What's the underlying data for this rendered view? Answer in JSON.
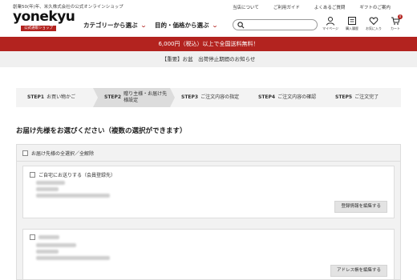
{
  "header": {
    "tagline": "創業50(年)年、米久株式会社の公式オンラインショップ",
    "logo": "yonekyu",
    "logo_sub": "公式通販ショップ",
    "nav_category": "カテゴリーから選ぶ",
    "nav_occasion": "目的・価格から選ぶ",
    "util_links": [
      "当店について",
      "ご利用ガイド",
      "よくあるご質問",
      "ギフトのご案内"
    ],
    "icons": [
      {
        "name": "user-icon",
        "label": "マイページ"
      },
      {
        "name": "history-icon",
        "label": "購入履歴"
      },
      {
        "name": "heart-icon",
        "label": "お気に入り"
      },
      {
        "name": "cart-icon",
        "label": "カート",
        "badge": "0"
      }
    ]
  },
  "banner": {
    "shipping": "6,000円（税込）以上で全国送料無料！",
    "notice": "【重要】お盆　出荷停止期間のお知らせ"
  },
  "steps": [
    {
      "num": "STEP1",
      "label": "お買い物かご"
    },
    {
      "num": "STEP2",
      "label": "贈り主様・お届け先様設定"
    },
    {
      "num": "STEP3",
      "label": "ご注文内容の指定"
    },
    {
      "num": "STEP4",
      "label": "ご注文内容の確認"
    },
    {
      "num": "STEP5",
      "label": "ご注文完了"
    }
  ],
  "main": {
    "title": "お届け先様をお選びください（複数の選択ができます）",
    "select_all": "お届け先様の全選択／全解除",
    "card1_title": "ご自宅にお送りする（会員登録先）",
    "card1_button": "登録情報を編集する",
    "card2_button": "アドレス帳を編集する"
  },
  "colors": {
    "brand_red": "#b3231f",
    "notice_bg": "#f0f0f0"
  }
}
